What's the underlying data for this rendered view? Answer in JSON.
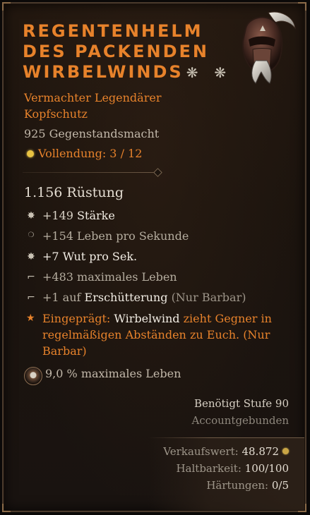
{
  "item": {
    "name": "Regentenhelm des packenden Wirbelwinds",
    "title_lines": [
      "REGENTENHELM",
      "DES PACKENDEN",
      "WIRBELWINDS"
    ],
    "stars": "❋ ❋",
    "rarity_line1": "Vermachter Legendärer",
    "rarity_line2": "Kopfschutz",
    "item_power": "925 Gegenstandsmacht",
    "masterwork": "Vollendung: 3 / 12"
  },
  "armor": "1.156 Rüstung",
  "stats": [
    {
      "icon": "✸",
      "icon_name": "star-burst-icon",
      "value": "+149",
      "label": "Stärke"
    },
    {
      "icon": "❍",
      "icon_name": "small-ring-icon",
      "value": "+154",
      "label": "Leben pro Sekunde"
    },
    {
      "icon": "✸",
      "icon_name": "star-burst-icon",
      "value": "+7",
      "label": "Wut pro Sek."
    },
    {
      "icon": "⌐",
      "icon_name": "anvil-icon",
      "value": "+483",
      "label": "maximales Leben"
    },
    {
      "icon": "⌐",
      "icon_name": "anvil-icon",
      "prefix": "+1 auf",
      "skill": "Erschütterung",
      "suffix": "(Nur Barbar)"
    }
  ],
  "aspect": {
    "label": "Eingeprägt:",
    "skill": "Wirbelwind",
    "text": "zieht Gegner in regelmäßigen Abständen zu Euch. (Nur Barbar)"
  },
  "gem": {
    "text": "9,0 % maximales Leben"
  },
  "requirements": {
    "level": "Benötigt Stufe 90",
    "bound": "Accountgebunden"
  },
  "footer": {
    "sell_label": "Verkaufswert:",
    "sell_value": "48.872",
    "durability_label": "Haltbarkeit:",
    "durability_value": "100/100",
    "tempers_label": "Härtungen:",
    "tempers_value": "0/5"
  },
  "colors": {
    "legendary": "#e7822b",
    "text": "#d9d2c6",
    "muted": "#8e877d",
    "gold": "#e8c242"
  }
}
